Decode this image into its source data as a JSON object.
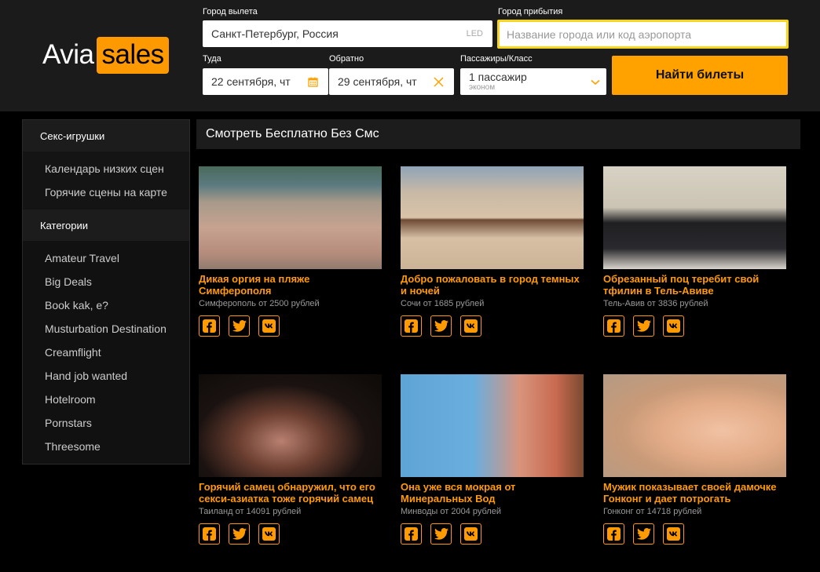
{
  "logo": {
    "part1": "Avia",
    "part2": "sales"
  },
  "search": {
    "origin": {
      "label": "Город вылета",
      "value": "Санкт-Петербург, Россия",
      "iata": "LED"
    },
    "destination": {
      "label": "Город прибытия",
      "placeholder": "Название города или код аэропорта"
    },
    "depart": {
      "label": "Туда",
      "value": "22 сентября, чт"
    },
    "return": {
      "label": "Обратно",
      "value": "29 сентября, чт"
    },
    "passengers": {
      "label": "Пассажиры/Класс",
      "value": "1 пассажир",
      "class": "эконом"
    },
    "submit_label": "Найти билеты"
  },
  "sidebar": {
    "section1": {
      "title": "Секс-игрушки",
      "items": [
        "Календарь низких сцен",
        "Горячие сцены на карте"
      ]
    },
    "section2": {
      "title": "Категории",
      "items": [
        "Amateur Travel",
        "Big Deals",
        "Book kak, e?",
        "Musturbation Destination",
        "Creamflight",
        "Hand job wanted",
        "Hotelroom",
        "Pornstars",
        "Threesome"
      ]
    }
  },
  "main": {
    "heading": "Смотреть Бесплатно Без Смс",
    "cards": [
      {
        "title": "Дикая оргия на пляже Симферополя",
        "price": "Симферополь от 2500 рублей",
        "image": "crowded-beach-photo"
      },
      {
        "title": "Добро пожаловать в город темных и ночей",
        "price": "Сочи от 1685 рублей",
        "image": "men-on-beach-photo"
      },
      {
        "title": "Обрезанный поц теребит свой тфилин в Тель-Авиве",
        "price": "Тель-Авив от 3836 рублей",
        "image": "western-wall-photo"
      },
      {
        "title": "Горячий самец обнаружил, что его секси-азиатка тоже горячий самец",
        "price": "Таиланд от 14091 рублей",
        "image": "couple-photo"
      },
      {
        "title": "Она уже вся мокрая от Минеральных Вод",
        "price": "Минводы от 2004 рублей",
        "image": "water-bottle-photo"
      },
      {
        "title": "Мужик показывает своей дамочке Гонконг и дает потрогать",
        "price": "Гонконг от 14718 рублей",
        "image": "bubblegum-photo"
      }
    ],
    "share_icons": [
      "facebook-icon",
      "twitter-icon",
      "vk-icon"
    ]
  },
  "colors": {
    "accent": "#ff9b00",
    "button": "#ffa200",
    "header_bg": "#1b1b1b",
    "focus_border": "#f5d61c"
  }
}
